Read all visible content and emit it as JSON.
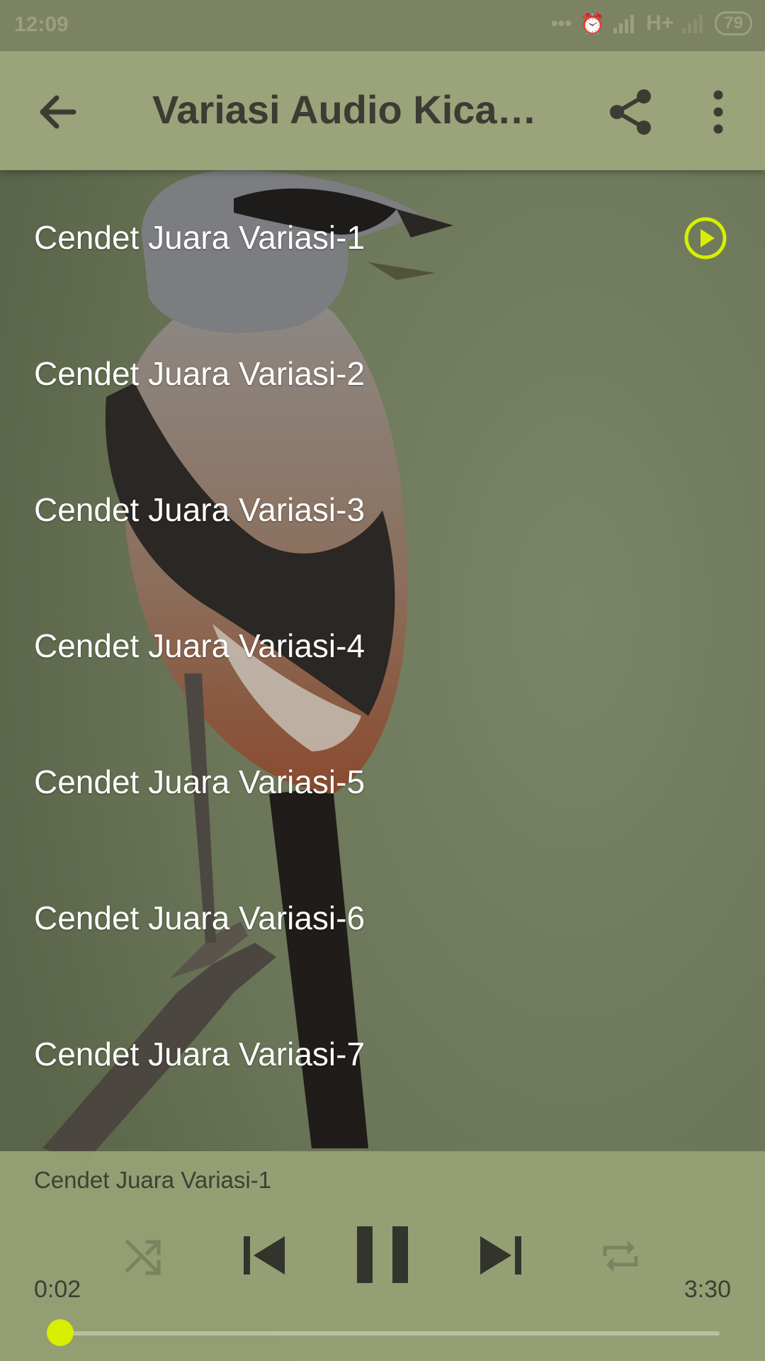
{
  "status_bar": {
    "time": "12:09",
    "network": "H+",
    "battery": "79",
    "icons": [
      "dots-icon",
      "alarm-icon",
      "signal-icon",
      "signal-icon-secondary",
      "battery-icon"
    ]
  },
  "app_bar": {
    "title": "Variasi Audio Kicau Cendet Juara",
    "icons": [
      "back-arrow-icon",
      "share-icon",
      "more-vert-icon"
    ]
  },
  "tracks": [
    {
      "label": "Cendet Juara Variasi-1",
      "playing": true
    },
    {
      "label": "Cendet Juara Variasi-2"
    },
    {
      "label": "Cendet Juara Variasi-3"
    },
    {
      "label": "Cendet Juara Variasi-4"
    },
    {
      "label": "Cendet Juara Variasi-5"
    },
    {
      "label": "Cendet Juara Variasi-6"
    },
    {
      "label": "Cendet Juara Variasi-7"
    }
  ],
  "player": {
    "now_playing": "Cendet Juara Variasi-1",
    "elapsed": "0:02",
    "total": "3:30",
    "progress_fraction": 0.0095,
    "controls": [
      "shuffle-icon",
      "previous-icon",
      "pause-icon",
      "next-icon",
      "repeat-icon"
    ]
  },
  "colors": {
    "accent": "#d7ef00",
    "app_bar": "#9aa37a",
    "player_panel": "#98a276",
    "text_dark": "#3b3c33"
  }
}
